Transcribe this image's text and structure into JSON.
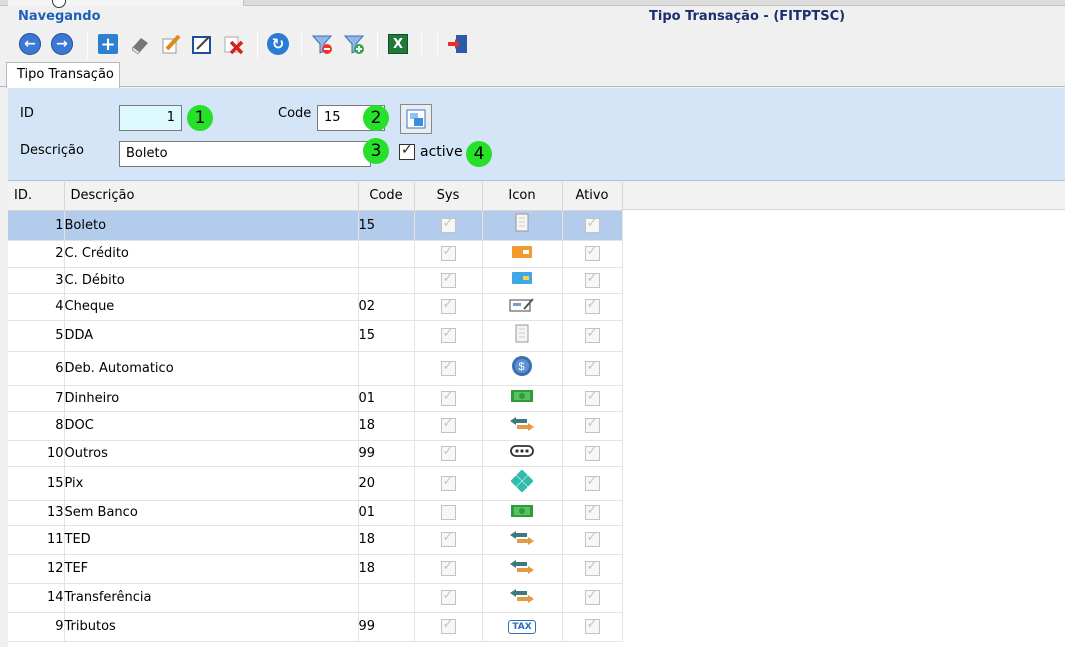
{
  "header": {
    "nav_label": "Navegando",
    "window_title": "Tipo Transação - (FITPTSC)"
  },
  "toolbar": {
    "buttons": [
      "back-icon",
      "forward-icon",
      "add-icon",
      "eraser-icon",
      "edit-icon",
      "edit-form-icon",
      "delete-icon",
      "refresh-icon",
      "filter-remove-icon",
      "filter-add-icon",
      "excel-icon",
      "exit-icon"
    ]
  },
  "tabs": [
    {
      "label": "Tipo Transação"
    }
  ],
  "form": {
    "id_label": "ID",
    "id_value": "1",
    "code_label": "Code",
    "code_value": "15",
    "desc_label": "Descrição",
    "desc_value": "Boleto",
    "active_label": "active",
    "active_checked": true,
    "badges": [
      "1",
      "2",
      "3",
      "4"
    ]
  },
  "grid": {
    "columns": [
      "ID.",
      "Descrição",
      "Code",
      "Sys",
      "Icon",
      "Ativo"
    ],
    "rows": [
      {
        "id": "1",
        "desc": "Boleto",
        "code": "15",
        "sys": true,
        "icon": "boleto-icon",
        "ativo": true
      },
      {
        "id": "2",
        "desc": "C. Crédito",
        "code": "",
        "sys": true,
        "icon": "credit-card-icon",
        "ativo": true
      },
      {
        "id": "3",
        "desc": "C. Débito",
        "code": "",
        "sys": true,
        "icon": "debit-card-icon",
        "ativo": true
      },
      {
        "id": "4",
        "desc": "Cheque",
        "code": "02",
        "sys": true,
        "icon": "cheque-icon",
        "ativo": true
      },
      {
        "id": "5",
        "desc": "DDA",
        "code": "15",
        "sys": true,
        "icon": "boleto-icon",
        "ativo": true
      },
      {
        "id": "6",
        "desc": "Deb. Automatico",
        "code": "",
        "sys": true,
        "icon": "coin-icon",
        "ativo": true
      },
      {
        "id": "7",
        "desc": "Dinheiro",
        "code": "01",
        "sys": true,
        "icon": "cash-icon",
        "ativo": true
      },
      {
        "id": "8",
        "desc": "DOC",
        "code": "18",
        "sys": true,
        "icon": "transfer-icon",
        "ativo": true
      },
      {
        "id": "10",
        "desc": "Outros",
        "code": "99",
        "sys": true,
        "icon": "more-icon",
        "ativo": true
      },
      {
        "id": "15",
        "desc": "Pix",
        "code": "20",
        "sys": true,
        "icon": "pix-icon",
        "ativo": true
      },
      {
        "id": "13",
        "desc": "Sem Banco",
        "code": "01",
        "sys": false,
        "icon": "cash-icon",
        "ativo": true
      },
      {
        "id": "11",
        "desc": "TED",
        "code": "18",
        "sys": true,
        "icon": "transfer-icon",
        "ativo": true
      },
      {
        "id": "12",
        "desc": "TEF",
        "code": "18",
        "sys": true,
        "icon": "transfer-icon",
        "ativo": true
      },
      {
        "id": "14",
        "desc": "Transferência",
        "code": "",
        "sys": true,
        "icon": "transfer-icon",
        "ativo": true
      },
      {
        "id": "9",
        "desc": "Tributos",
        "code": "99",
        "sys": true,
        "icon": "tax-icon",
        "ativo": true
      }
    ],
    "selected_row": 0,
    "tax_icon_text": "TAX"
  }
}
